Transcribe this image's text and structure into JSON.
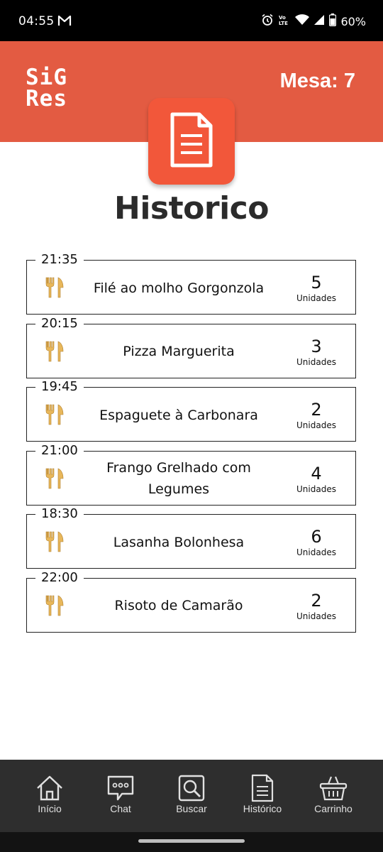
{
  "status_bar": {
    "time": "04:55",
    "battery": "60%",
    "icons": [
      "gmail-icon",
      "alarm-icon",
      "volte-icon",
      "wifi-icon",
      "signal-icon",
      "battery-icon"
    ]
  },
  "header": {
    "logo_line1": "SiG",
    "logo_line2": "Res",
    "mesa": "Mesa: 7",
    "background": "#E35B42"
  },
  "page": {
    "badge_icon": "document-icon",
    "title": "Historico"
  },
  "orders": [
    {
      "time": "21:35",
      "name": "Filé ao molho Gorgonzola",
      "qty": "5",
      "unit": "Unidades"
    },
    {
      "time": "20:15",
      "name": "Pizza Marguerita",
      "qty": "3",
      "unit": "Unidades"
    },
    {
      "time": "19:45",
      "name": "Espaguete à Carbonara",
      "qty": "2",
      "unit": "Unidades"
    },
    {
      "time": "21:00",
      "name": "Frango Grelhado com Legumes",
      "qty": "4",
      "unit": "Unidades"
    },
    {
      "time": "18:30",
      "name": "Lasanha Bolonhesa",
      "qty": "6",
      "unit": "Unidades"
    },
    {
      "time": "22:00",
      "name": "Risoto de Camarão",
      "qty": "2",
      "unit": "Unidades"
    }
  ],
  "nav": {
    "items": [
      {
        "label": "Início",
        "icon": "home-icon"
      },
      {
        "label": "Chat",
        "icon": "chat-icon"
      },
      {
        "label": "Buscar",
        "icon": "search-icon"
      },
      {
        "label": "Histórico",
        "icon": "document-icon"
      },
      {
        "label": "Carrinho",
        "icon": "basket-icon"
      }
    ]
  },
  "colors": {
    "accent": "#E35B42",
    "badge": "#F2573A",
    "cutlery": "#E8B75A",
    "nav_bg": "#2e2e2e"
  }
}
